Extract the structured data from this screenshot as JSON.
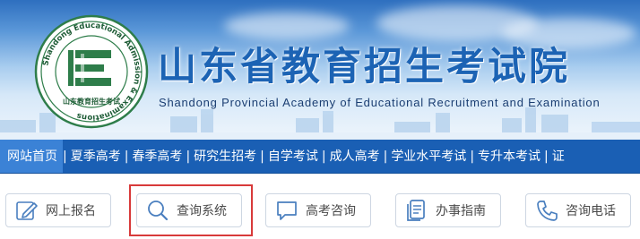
{
  "header": {
    "title": "山东省教育招生考试院",
    "subtitle": "Shandong Provincial Academy of Educational Recruitment and Examination",
    "logo": {
      "ring_text": "Shandong Educational Admission & Examinations",
      "inner_text": "山东教育招生考试",
      "icon": "e-emblem-icon"
    }
  },
  "nav": {
    "items": [
      {
        "label": "网站首页",
        "active": true
      },
      {
        "label": "夏季高考"
      },
      {
        "label": "春季高考"
      },
      {
        "label": "研究生招考"
      },
      {
        "label": "自学考试"
      },
      {
        "label": "成人高考"
      },
      {
        "label": "学业水平考试"
      },
      {
        "label": "专升本考试"
      },
      {
        "label": "证"
      }
    ],
    "separator": "|"
  },
  "quick_links": [
    {
      "label": "网上报名",
      "icon": "pencil-edit-icon"
    },
    {
      "label": "查询系统",
      "icon": "search-icon",
      "highlighted": true
    },
    {
      "label": "高考咨询",
      "icon": "chat-bubble-icon"
    },
    {
      "label": "办事指南",
      "icon": "document-icon"
    },
    {
      "label": "咨询电话",
      "icon": "phone-icon"
    }
  ],
  "colors": {
    "brand_blue": "#1a5fb4",
    "nav_active": "#3b82d6",
    "title_blue": "#1c63b4",
    "logo_green": "#2e7d4a",
    "highlight_red": "#d83a3a"
  }
}
